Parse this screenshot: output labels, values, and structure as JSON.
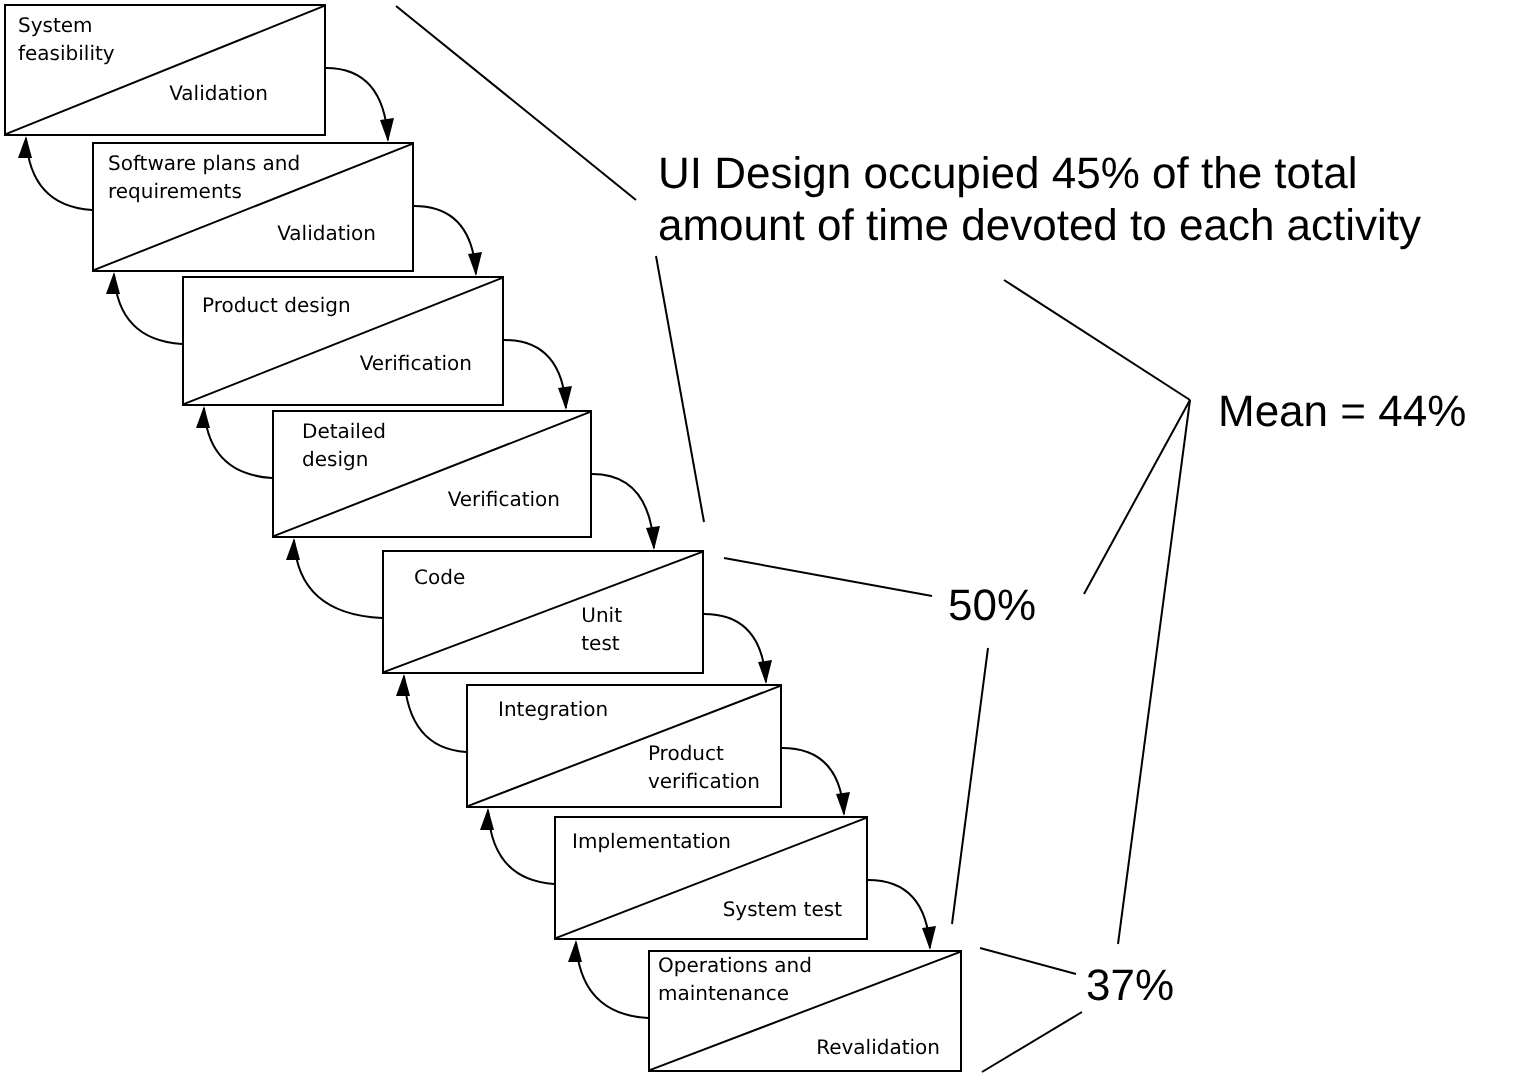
{
  "phases": [
    {
      "name_lines": [
        "System",
        "feasibility"
      ],
      "check_lines": [
        "Validation"
      ]
    },
    {
      "name_lines": [
        "Software plans and",
        "requirements"
      ],
      "check_lines": [
        "Validation"
      ]
    },
    {
      "name_lines": [
        "Product design"
      ],
      "check_lines": [
        "Verification"
      ]
    },
    {
      "name_lines": [
        "Detailed",
        "design"
      ],
      "check_lines": [
        "Verification"
      ]
    },
    {
      "name_lines": [
        "Code"
      ],
      "check_lines": [
        "Unit",
        "test"
      ]
    },
    {
      "name_lines": [
        "Integration"
      ],
      "check_lines": [
        "Product",
        "verification"
      ]
    },
    {
      "name_lines": [
        "Implementation"
      ],
      "check_lines": [
        "System test"
      ]
    },
    {
      "name_lines": [
        "Operations and",
        "maintenance"
      ],
      "check_lines": [
        "Revalidation"
      ]
    }
  ],
  "headline_lines": [
    "UI Design occupied 45% of the total",
    "amount of time devoted to each activity"
  ],
  "mean_label": "Mean = 44%",
  "design_share": "50%",
  "operations_share": "37%"
}
